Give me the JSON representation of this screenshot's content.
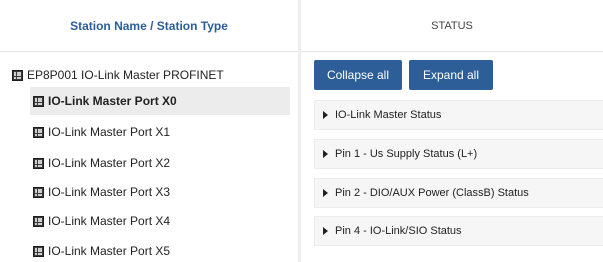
{
  "left_panel": {
    "header": "Station Name / Station Type",
    "root": {
      "label": "EP8P001 IO-Link Master PROFINET",
      "icon": "device-node-icon"
    },
    "children": [
      {
        "label": "IO-Link Master Port X0",
        "selected": true,
        "icon": "port-node-icon"
      },
      {
        "label": "IO-Link Master Port X1",
        "selected": false,
        "icon": "port-node-icon"
      },
      {
        "label": "IO-Link Master Port X2",
        "selected": false,
        "icon": "port-node-icon"
      },
      {
        "label": "IO-Link Master Port X3",
        "selected": false,
        "icon": "port-node-icon"
      },
      {
        "label": "IO-Link Master Port X4",
        "selected": false,
        "icon": "port-node-icon"
      },
      {
        "label": "IO-Link Master Port X5",
        "selected": false,
        "icon": "port-node-icon"
      }
    ]
  },
  "right_panel": {
    "header": "STATUS",
    "buttons": {
      "collapse_all": "Collapse all",
      "expand_all": "Expand all"
    },
    "sections": [
      {
        "label": "IO-Link Master Status",
        "expanded": false
      },
      {
        "label": "Pin 1 - Us Supply Status (L+)",
        "expanded": false
      },
      {
        "label": "Pin 2 - DIO/AUX Power (ClassB) Status",
        "expanded": false
      },
      {
        "label": "Pin 4 - IO-Link/SIO Status",
        "expanded": false
      }
    ]
  },
  "colors": {
    "header_text": "#2b5e9a",
    "button_bg": "#2e5e98",
    "selected_bg": "#ececec",
    "accordion_bg": "#f6f6f6"
  }
}
